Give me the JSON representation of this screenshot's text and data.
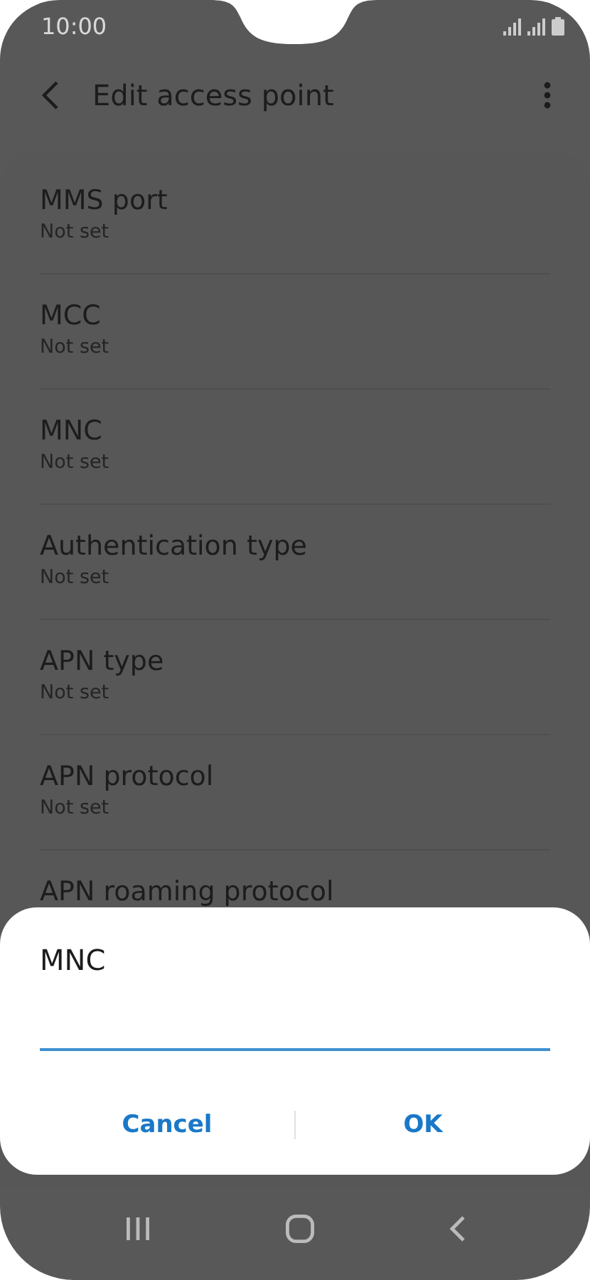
{
  "status_bar": {
    "time": "10:00"
  },
  "app_bar": {
    "title": "Edit access point"
  },
  "settings": [
    {
      "title": "MMS port",
      "summary": "Not set"
    },
    {
      "title": "MCC",
      "summary": "Not set"
    },
    {
      "title": "MNC",
      "summary": "Not set"
    },
    {
      "title": "Authentication type",
      "summary": "Not set"
    },
    {
      "title": "APN type",
      "summary": "Not set"
    },
    {
      "title": "APN protocol",
      "summary": "Not set"
    },
    {
      "title": "APN roaming protocol"
    }
  ],
  "dialog": {
    "title": "MNC",
    "buttons": [
      "Cancel",
      "OK"
    ]
  }
}
